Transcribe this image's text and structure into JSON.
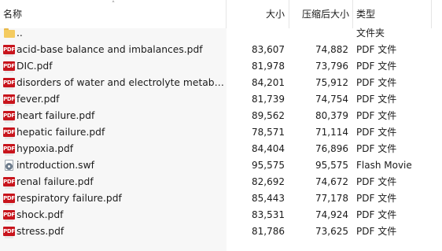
{
  "header": {
    "name": "名称",
    "size": "大小",
    "compressed_size": "压缩后大小",
    "type": "类型"
  },
  "rows": [
    {
      "icon": "folder-icon",
      "name": "..",
      "size": "",
      "compressed_size": "",
      "type": "文件夹"
    },
    {
      "icon": "pdf-icon",
      "name": "acid-base balance and imbalances.pdf",
      "size": "83,607",
      "compressed_size": "74,882",
      "type": "PDF 文件"
    },
    {
      "icon": "pdf-icon",
      "name": "DIC.pdf",
      "size": "81,978",
      "compressed_size": "73,796",
      "type": "PDF 文件"
    },
    {
      "icon": "pdf-icon",
      "name": "disorders of water and electrolyte metaboli...",
      "size": "84,201",
      "compressed_size": "75,912",
      "type": "PDF 文件"
    },
    {
      "icon": "pdf-icon",
      "name": "fever.pdf",
      "size": "81,739",
      "compressed_size": "74,754",
      "type": "PDF 文件"
    },
    {
      "icon": "pdf-icon",
      "name": "heart failure.pdf",
      "size": "89,562",
      "compressed_size": "80,379",
      "type": "PDF 文件"
    },
    {
      "icon": "pdf-icon",
      "name": "hepatic failure.pdf",
      "size": "78,571",
      "compressed_size": "71,114",
      "type": "PDF 文件"
    },
    {
      "icon": "pdf-icon",
      "name": "hypoxia.pdf",
      "size": "84,404",
      "compressed_size": "76,896",
      "type": "PDF 文件"
    },
    {
      "icon": "swf-icon",
      "name": "introduction.swf",
      "size": "95,575",
      "compressed_size": "95,575",
      "type": "Flash Movie"
    },
    {
      "icon": "pdf-icon",
      "name": "renal failure.pdf",
      "size": "82,692",
      "compressed_size": "74,672",
      "type": "PDF 文件"
    },
    {
      "icon": "pdf-icon",
      "name": "respiratory failure.pdf",
      "size": "85,443",
      "compressed_size": "77,178",
      "type": "PDF 文件"
    },
    {
      "icon": "pdf-icon",
      "name": "shock.pdf",
      "size": "83,531",
      "compressed_size": "74,924",
      "type": "PDF 文件"
    },
    {
      "icon": "pdf-icon",
      "name": "stress.pdf",
      "size": "81,786",
      "compressed_size": "73,625",
      "type": "PDF 文件"
    }
  ],
  "pdf_icon_text": "PDF"
}
